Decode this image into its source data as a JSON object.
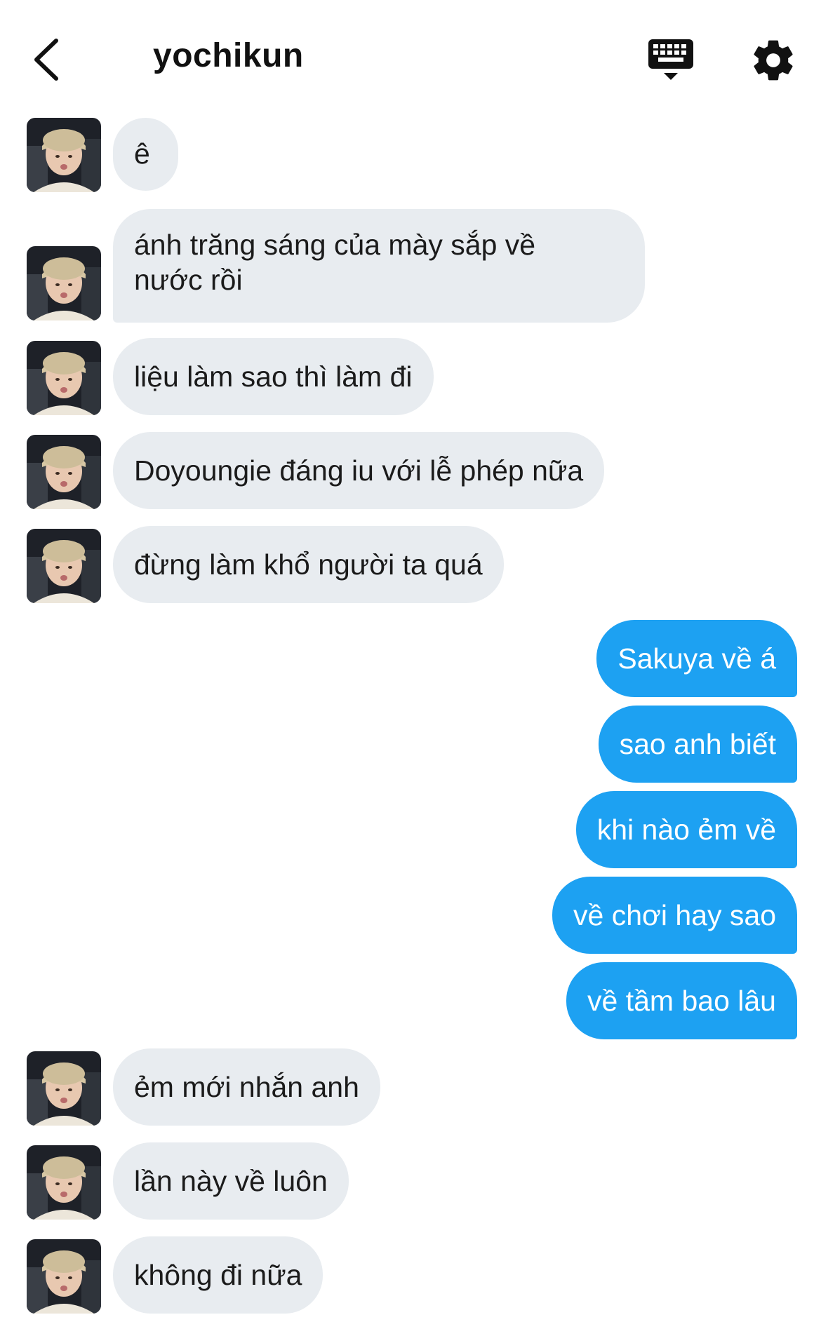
{
  "header": {
    "title": "yochikun",
    "back_icon": "chevron-left-icon",
    "keyboard_icon": "keyboard-icon",
    "settings_icon": "gear-icon"
  },
  "colors": {
    "incoming_bubble": "#e8ecf0",
    "outgoing_bubble": "#1da1f2"
  },
  "messages": [
    {
      "from": "them",
      "text": "ê"
    },
    {
      "from": "them",
      "text": "ánh trăng sáng của mày sắp về",
      "text2": "nước rồi"
    },
    {
      "from": "them",
      "text": "liệu làm sao thì làm đi"
    },
    {
      "from": "them",
      "text": "Doyoungie đáng iu với lễ phép nữa"
    },
    {
      "from": "them",
      "text": "đừng làm khổ người ta quá"
    },
    {
      "from": "me",
      "text": "Sakuya về á"
    },
    {
      "from": "me",
      "text": "sao anh biết"
    },
    {
      "from": "me",
      "text": "khi nào ẻm về"
    },
    {
      "from": "me",
      "text": "về chơi hay sao"
    },
    {
      "from": "me",
      "text": "về tầm bao lâu"
    },
    {
      "from": "them",
      "text": "ẻm mới nhắn anh"
    },
    {
      "from": "them",
      "text": "lần này về luôn"
    },
    {
      "from": "them",
      "text": "không đi nữa"
    }
  ]
}
